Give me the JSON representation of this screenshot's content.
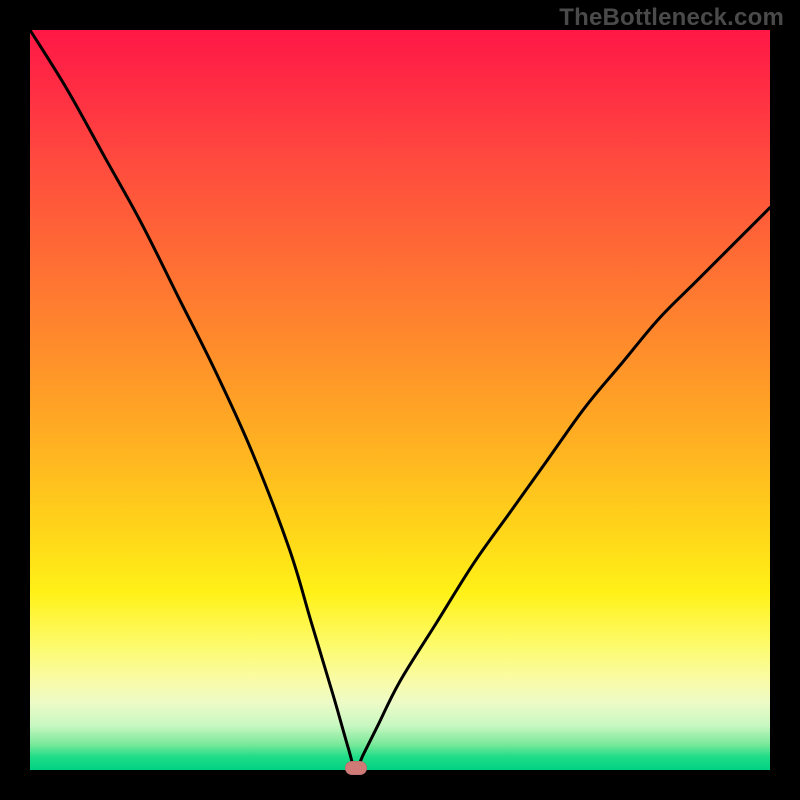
{
  "watermark": "TheBottleneck.com",
  "colors": {
    "frame": "#000000",
    "curve_stroke": "#000000",
    "marker": "#cf7a76",
    "gradient_top": "#ff1846",
    "gradient_bottom": "#00d183"
  },
  "chart_data": {
    "type": "line",
    "title": "",
    "xlabel": "",
    "ylabel": "",
    "xlim": [
      0,
      100
    ],
    "ylim": [
      0,
      100
    ],
    "grid": false,
    "notes": "Bottleneck-style V-curve on a vertical heat gradient (red=high bottleneck at top, green=balanced at bottom). Curve reaches 0 near x≈44.",
    "series": [
      {
        "name": "bottleneck-curve",
        "x": [
          0,
          5,
          10,
          15,
          20,
          25,
          30,
          35,
          38,
          41,
          43,
          44,
          45,
          47,
          50,
          55,
          60,
          65,
          70,
          75,
          80,
          85,
          90,
          95,
          100
        ],
        "values": [
          100,
          92,
          83,
          74,
          64,
          54,
          43,
          30,
          20,
          10,
          3,
          0,
          2,
          6,
          12,
          20,
          28,
          35,
          42,
          49,
          55,
          61,
          66,
          71,
          76
        ]
      }
    ],
    "marker": {
      "x": 44,
      "y": 0
    }
  }
}
